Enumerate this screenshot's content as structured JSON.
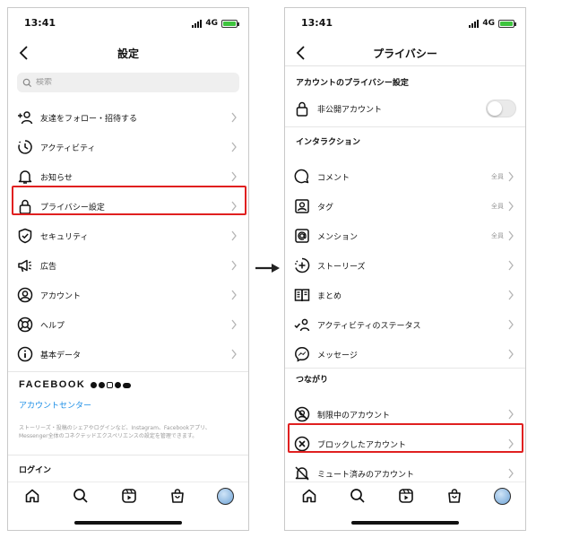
{
  "left": {
    "status": {
      "time": "13:41",
      "network": "4G"
    },
    "title": "設定",
    "search": {
      "placeholder": "検索"
    },
    "items": [
      {
        "label": "友達をフォロー・招待する",
        "icon": "add-person-icon"
      },
      {
        "label": "アクティビティ",
        "icon": "activity-icon"
      },
      {
        "label": "お知らせ",
        "icon": "bell-icon"
      },
      {
        "label": "プライバシー設定",
        "icon": "lock-icon"
      },
      {
        "label": "セキュリティ",
        "icon": "shield-icon"
      },
      {
        "label": "広告",
        "icon": "megaphone-icon"
      },
      {
        "label": "アカウント",
        "icon": "account-circle-icon"
      },
      {
        "label": "ヘルプ",
        "icon": "lifebuoy-icon"
      },
      {
        "label": "基本データ",
        "icon": "info-icon"
      }
    ],
    "facebook": {
      "brand": "FACEBOOK",
      "accounts_center": "アカウントセンター",
      "description": "ストーリーズ・投稿のシェアやログインなど、Instagram、Facebookアプリ、Messenger全体のコネクテッドエクスペリエンスの設定を管理できます。"
    },
    "login_header": "ログイン",
    "highlighted_item": "プライバシー設定"
  },
  "right": {
    "status": {
      "time": "13:41",
      "network": "4G"
    },
    "title": "プライバシー",
    "account_privacy": {
      "header": "アカウントのプライバシー設定",
      "private_account": {
        "label": "非公開アカウント",
        "enabled": false
      }
    },
    "interactions": {
      "header": "インタラクション",
      "items": [
        {
          "label": "コメント",
          "value": "全員",
          "icon": "comment-icon"
        },
        {
          "label": "タグ",
          "value": "全員",
          "icon": "tag-person-icon"
        },
        {
          "label": "メンション",
          "value": "全員",
          "icon": "at-sign-icon"
        },
        {
          "label": "ストーリーズ",
          "value": "",
          "icon": "story-add-icon"
        },
        {
          "label": "まとめ",
          "value": "",
          "icon": "guide-book-icon"
        },
        {
          "label": "アクティビティのステータス",
          "value": "",
          "icon": "activity-status-icon"
        },
        {
          "label": "メッセージ",
          "value": "",
          "icon": "messenger-icon"
        }
      ]
    },
    "connections": {
      "header": "つながり",
      "items": [
        {
          "label": "制限中のアカウント",
          "icon": "restricted-icon"
        },
        {
          "label": "ブロックしたアカウント",
          "icon": "blocked-icon"
        },
        {
          "label": "ミュート済みのアカウント",
          "icon": "muted-icon"
        }
      ]
    },
    "highlighted_item": "ブロックしたアカウント"
  },
  "colors": {
    "highlight": "#e02020",
    "link": "#1a8de6",
    "battery": "#3ec43e"
  }
}
